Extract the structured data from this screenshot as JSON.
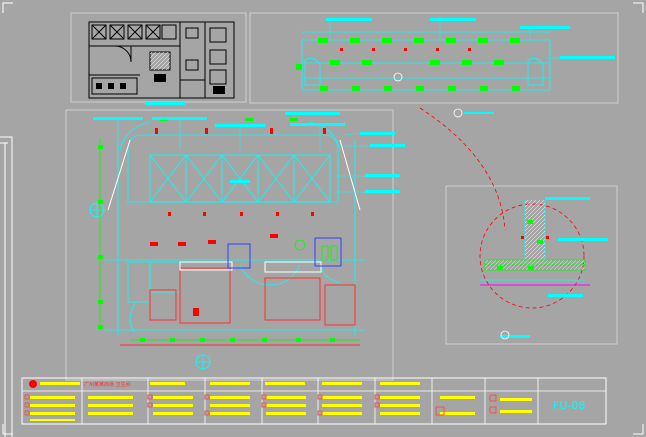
{
  "drawing": {
    "sheet_code": "FU-08",
    "background_color": "#a5a5a5",
    "line_colors": {
      "cyan": "#00ffff",
      "green": "#00ff00",
      "red": "#ff0000",
      "yellow": "#ffff00",
      "blue": "#0000ff",
      "magenta": "#ff00ff",
      "white": "#ffffff",
      "black": "#000000"
    }
  },
  "title_block": {
    "project_title": "广州某某商场 卫生间",
    "red_marker": "red-circle-logo"
  }
}
